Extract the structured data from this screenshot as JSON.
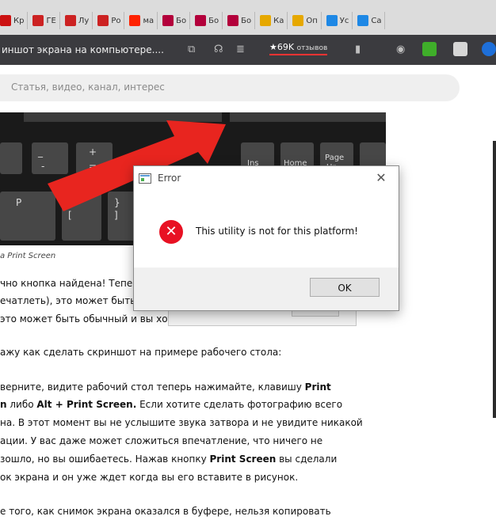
{
  "bookmarks": [
    {
      "label": "Кр",
      "icon": "opera-icon",
      "color": "#cc1111"
    },
    {
      "label": "ГЕ",
      "icon": "site-icon",
      "color": "#cc2222"
    },
    {
      "label": "Лу",
      "icon": "site-icon",
      "color": "#cc2222"
    },
    {
      "label": "Ро",
      "icon": "site-icon",
      "color": "#cc2222"
    },
    {
      "label": "ма",
      "icon": "yandex-icon",
      "color": "#ff2200"
    },
    {
      "label": "Бо",
      "icon": "wildberries-icon",
      "color": "#b3003b"
    },
    {
      "label": "Бо",
      "icon": "wildberries-icon",
      "color": "#b3003b"
    },
    {
      "label": "Бо",
      "icon": "wildberries-icon",
      "color": "#b3003b"
    },
    {
      "label": "Ка",
      "icon": "ball-icon",
      "color": "#e6a800"
    },
    {
      "label": "Оп",
      "icon": "ball-icon",
      "color": "#e6a800"
    },
    {
      "label": "Ус",
      "icon": "windows-icon",
      "color": "#1e88e5"
    },
    {
      "label": "Са",
      "icon": "windows-icon",
      "color": "#1e88e5"
    }
  ],
  "address_bar": {
    "title": "иншот экрана на компьютере....",
    "rating": "★69K",
    "rating_sub": "отзывов"
  },
  "search": {
    "placeholder": "Статья, видео, канал, интерес"
  },
  "keyboard": {
    "keys": [
      "Ins",
      "Home",
      "Page",
      "Up"
    ]
  },
  "article": {
    "caption": "a Print Screen",
    "p1_line1": "чно кнопка найдена! Тепе",
    "p1_line2": "ечатлеть), это может быть",
    "p1_line3": "это может быть обычный  и вы хотите сохранить чек об оплате.",
    "p2": "ажу как сделать скриншот на примере рабочего стола:",
    "p3_a": "верните, видите рабочий стол теперь нажимайте, клавишу ",
    "p3_a_bold": "Print",
    "p3_b_bold1": "n",
    "p3_b_mid": " либо ",
    "p3_b_bold2": "Alt + Print Screen.",
    "p3_b_rest": " Если хотите сделать фотографию всего",
    "p3_c": "на. В этот момент вы не услышите звука затвора и не увидите никакой",
    "p3_d": "ации. У вас даже может сложиться впечатление, что ничего не",
    "p3_e_a": "зошло, но вы ошибаетесь. Нажав кнопку ",
    "p3_e_bold": "Print Screen",
    "p3_e_b": " вы сделали",
    "p3_f": "ок экрана и он уже ждет когда вы его вставите в рисунок.",
    "p4": "е того, как снимок экрана оказался в буфере, нельзя копировать"
  },
  "ghost_dialog": {
    "ok": "OK"
  },
  "dialog": {
    "title": "Error",
    "close": "✕",
    "message": "This utility is not for this platform!",
    "ok": "OK",
    "error_symbol": "✕"
  }
}
